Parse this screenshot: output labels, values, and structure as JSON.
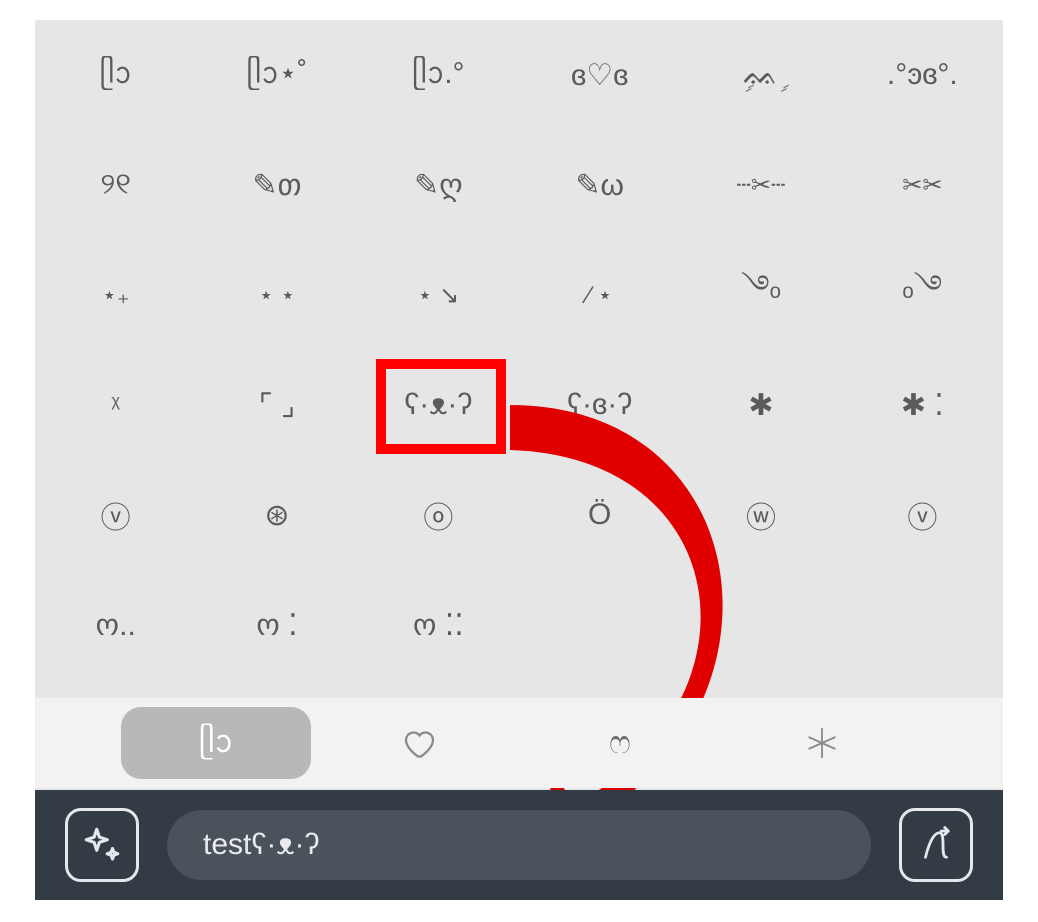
{
  "grid": {
    "rows": [
      [
        "ᥫᩣ",
        "ᥫᩣ⋆˚",
        "ᥫᩣ.°",
        "ɞ♡ɞ",
        "ࣲᨐࣲ",
        ".°ͽɞ°."
      ],
      [
        "୨୧",
        "✎თ",
        "✎ღ",
        "✎ω",
        "┄✂┄",
        "✂✂"
      ],
      [
        "⋆₊",
        "⋆ ⋆",
        "⋆ ↘",
        "∕ ⋆",
        "࿓ₒ",
        "ₒ࿓"
      ],
      [
        "ᵡ",
        "⌜ ⌟",
        "ʕ·ᴥ·ʔ",
        "ʕ·ɞ·ʔ",
        "✱",
        "✱ ⁚"
      ],
      [
        "ⓥ",
        "⊛",
        "ⓞ",
        "Ö",
        "ⓦ",
        "ⓥ"
      ],
      [
        "ო..",
        "ო ⁚",
        "ო ⁚⁚",
        "",
        "",
        ""
      ]
    ]
  },
  "tabs": {
    "items": [
      "ᥫᩣ",
      "♡",
      "ෆ",
      "✦"
    ],
    "active_index": 0
  },
  "input": {
    "value": "testʕ·ᴥ·ʔ"
  },
  "highlight": {
    "row": 3,
    "col": 2
  },
  "icons": {
    "left": "sparkles-icon",
    "right": "font-style-icon"
  }
}
